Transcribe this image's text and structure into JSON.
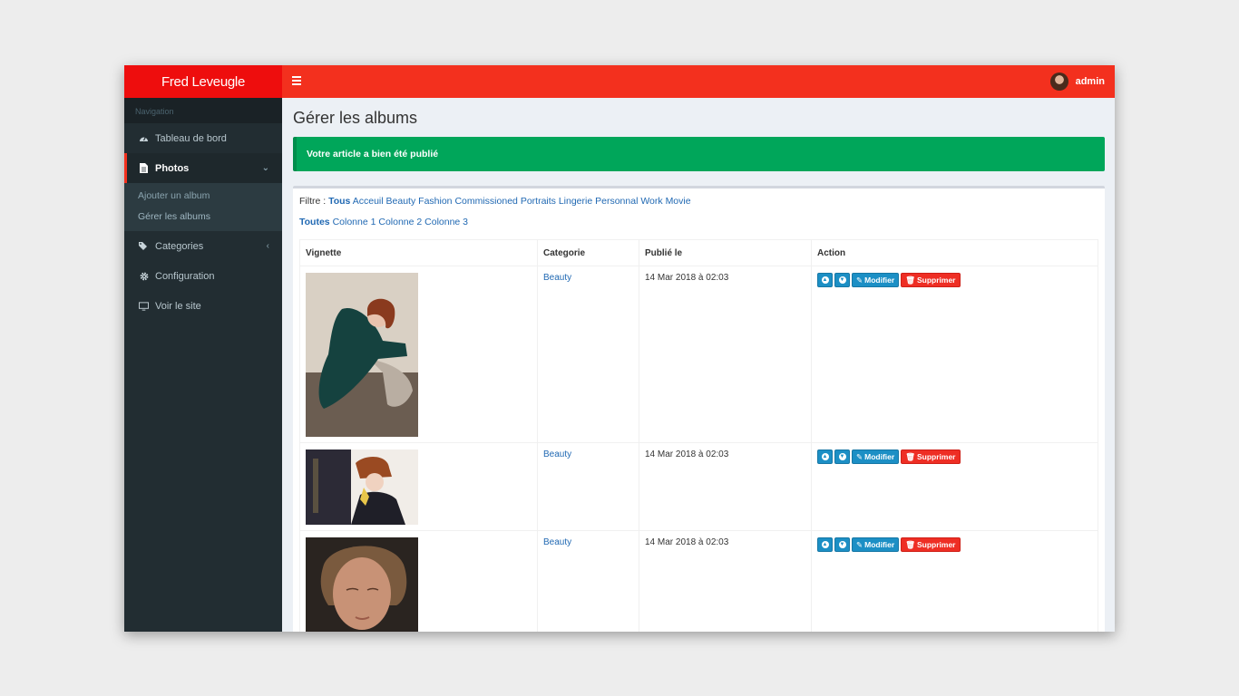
{
  "header": {
    "brand": "Fred Leveugle",
    "user_name": "admin"
  },
  "sidebar": {
    "section_label": "Navigation",
    "items": [
      {
        "label": "Tableau de bord",
        "icon": "dashboard-icon"
      },
      {
        "label": "Photos",
        "icon": "file-icon",
        "active": true
      },
      {
        "label": "Categories",
        "icon": "tags-icon"
      },
      {
        "label": "Configuration",
        "icon": "gear-icon"
      },
      {
        "label": "Voir le site",
        "icon": "desktop-icon"
      }
    ],
    "photos_sub": [
      "Ajouter un album",
      "Gérer les albums"
    ]
  },
  "main": {
    "title": "Gérer les albums",
    "alert": "Votre article a bien été publié",
    "filter_label": "Filtre :",
    "filters": [
      "Tous",
      "Acceuil",
      "Beauty",
      "Fashion",
      "Commissioned",
      "Portraits",
      "Lingerie",
      "Personnal Work",
      "Movie"
    ],
    "columns_filters": [
      "Toutes",
      "Colonne 1",
      "Colonne 2",
      "Colonne 3"
    ],
    "table": {
      "headers": [
        "Vignette",
        "Categorie",
        "Publié le",
        "Action"
      ],
      "rows": [
        {
          "category": "Beauty",
          "date": "14 Mar 2018 à 02:03"
        },
        {
          "category": "Beauty",
          "date": "14 Mar 2018 à 02:03"
        },
        {
          "category": "Beauty",
          "date": "14 Mar 2018 à 02:03"
        }
      ],
      "modify_label": "Modifier",
      "delete_label": "Supprimer"
    }
  },
  "colors": {
    "topbar": "#f3301e",
    "brand_bar": "#ee0d0d",
    "sidebar": "#222d32",
    "alert_success": "#00a65a",
    "btn_blue": "#1c8fc5",
    "btn_red": "#ee2e24"
  }
}
